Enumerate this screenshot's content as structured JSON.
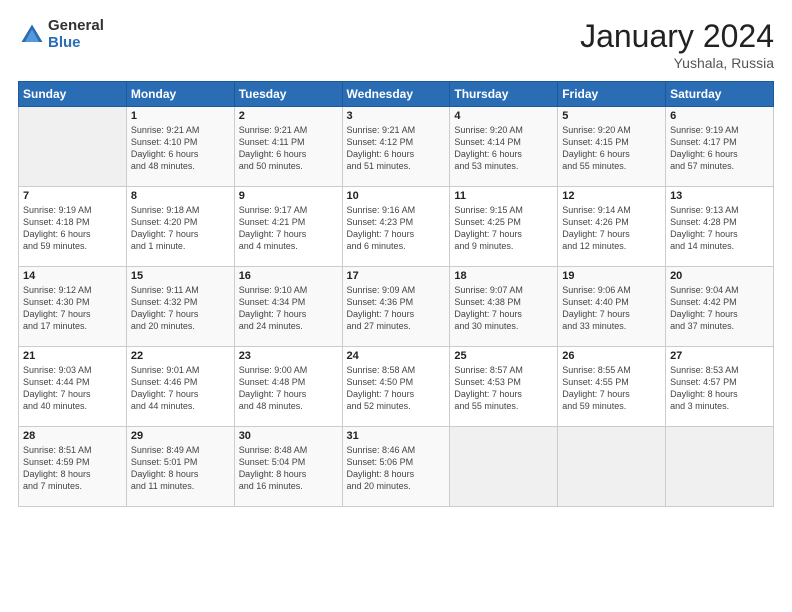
{
  "header": {
    "logo_general": "General",
    "logo_blue": "Blue",
    "title": "January 2024",
    "location": "Yushala, Russia"
  },
  "calendar": {
    "headers": [
      "Sunday",
      "Monday",
      "Tuesday",
      "Wednesday",
      "Thursday",
      "Friday",
      "Saturday"
    ],
    "weeks": [
      [
        {
          "day": "",
          "info": ""
        },
        {
          "day": "1",
          "info": "Sunrise: 9:21 AM\nSunset: 4:10 PM\nDaylight: 6 hours\nand 48 minutes."
        },
        {
          "day": "2",
          "info": "Sunrise: 9:21 AM\nSunset: 4:11 PM\nDaylight: 6 hours\nand 50 minutes."
        },
        {
          "day": "3",
          "info": "Sunrise: 9:21 AM\nSunset: 4:12 PM\nDaylight: 6 hours\nand 51 minutes."
        },
        {
          "day": "4",
          "info": "Sunrise: 9:20 AM\nSunset: 4:14 PM\nDaylight: 6 hours\nand 53 minutes."
        },
        {
          "day": "5",
          "info": "Sunrise: 9:20 AM\nSunset: 4:15 PM\nDaylight: 6 hours\nand 55 minutes."
        },
        {
          "day": "6",
          "info": "Sunrise: 9:19 AM\nSunset: 4:17 PM\nDaylight: 6 hours\nand 57 minutes."
        }
      ],
      [
        {
          "day": "7",
          "info": "Sunrise: 9:19 AM\nSunset: 4:18 PM\nDaylight: 6 hours\nand 59 minutes."
        },
        {
          "day": "8",
          "info": "Sunrise: 9:18 AM\nSunset: 4:20 PM\nDaylight: 7 hours\nand 1 minute."
        },
        {
          "day": "9",
          "info": "Sunrise: 9:17 AM\nSunset: 4:21 PM\nDaylight: 7 hours\nand 4 minutes."
        },
        {
          "day": "10",
          "info": "Sunrise: 9:16 AM\nSunset: 4:23 PM\nDaylight: 7 hours\nand 6 minutes."
        },
        {
          "day": "11",
          "info": "Sunrise: 9:15 AM\nSunset: 4:25 PM\nDaylight: 7 hours\nand 9 minutes."
        },
        {
          "day": "12",
          "info": "Sunrise: 9:14 AM\nSunset: 4:26 PM\nDaylight: 7 hours\nand 12 minutes."
        },
        {
          "day": "13",
          "info": "Sunrise: 9:13 AM\nSunset: 4:28 PM\nDaylight: 7 hours\nand 14 minutes."
        }
      ],
      [
        {
          "day": "14",
          "info": "Sunrise: 9:12 AM\nSunset: 4:30 PM\nDaylight: 7 hours\nand 17 minutes."
        },
        {
          "day": "15",
          "info": "Sunrise: 9:11 AM\nSunset: 4:32 PM\nDaylight: 7 hours\nand 20 minutes."
        },
        {
          "day": "16",
          "info": "Sunrise: 9:10 AM\nSunset: 4:34 PM\nDaylight: 7 hours\nand 24 minutes."
        },
        {
          "day": "17",
          "info": "Sunrise: 9:09 AM\nSunset: 4:36 PM\nDaylight: 7 hours\nand 27 minutes."
        },
        {
          "day": "18",
          "info": "Sunrise: 9:07 AM\nSunset: 4:38 PM\nDaylight: 7 hours\nand 30 minutes."
        },
        {
          "day": "19",
          "info": "Sunrise: 9:06 AM\nSunset: 4:40 PM\nDaylight: 7 hours\nand 33 minutes."
        },
        {
          "day": "20",
          "info": "Sunrise: 9:04 AM\nSunset: 4:42 PM\nDaylight: 7 hours\nand 37 minutes."
        }
      ],
      [
        {
          "day": "21",
          "info": "Sunrise: 9:03 AM\nSunset: 4:44 PM\nDaylight: 7 hours\nand 40 minutes."
        },
        {
          "day": "22",
          "info": "Sunrise: 9:01 AM\nSunset: 4:46 PM\nDaylight: 7 hours\nand 44 minutes."
        },
        {
          "day": "23",
          "info": "Sunrise: 9:00 AM\nSunset: 4:48 PM\nDaylight: 7 hours\nand 48 minutes."
        },
        {
          "day": "24",
          "info": "Sunrise: 8:58 AM\nSunset: 4:50 PM\nDaylight: 7 hours\nand 52 minutes."
        },
        {
          "day": "25",
          "info": "Sunrise: 8:57 AM\nSunset: 4:53 PM\nDaylight: 7 hours\nand 55 minutes."
        },
        {
          "day": "26",
          "info": "Sunrise: 8:55 AM\nSunset: 4:55 PM\nDaylight: 7 hours\nand 59 minutes."
        },
        {
          "day": "27",
          "info": "Sunrise: 8:53 AM\nSunset: 4:57 PM\nDaylight: 8 hours\nand 3 minutes."
        }
      ],
      [
        {
          "day": "28",
          "info": "Sunrise: 8:51 AM\nSunset: 4:59 PM\nDaylight: 8 hours\nand 7 minutes."
        },
        {
          "day": "29",
          "info": "Sunrise: 8:49 AM\nSunset: 5:01 PM\nDaylight: 8 hours\nand 11 minutes."
        },
        {
          "day": "30",
          "info": "Sunrise: 8:48 AM\nSunset: 5:04 PM\nDaylight: 8 hours\nand 16 minutes."
        },
        {
          "day": "31",
          "info": "Sunrise: 8:46 AM\nSunset: 5:06 PM\nDaylight: 8 hours\nand 20 minutes."
        },
        {
          "day": "",
          "info": ""
        },
        {
          "day": "",
          "info": ""
        },
        {
          "day": "",
          "info": ""
        }
      ]
    ]
  }
}
